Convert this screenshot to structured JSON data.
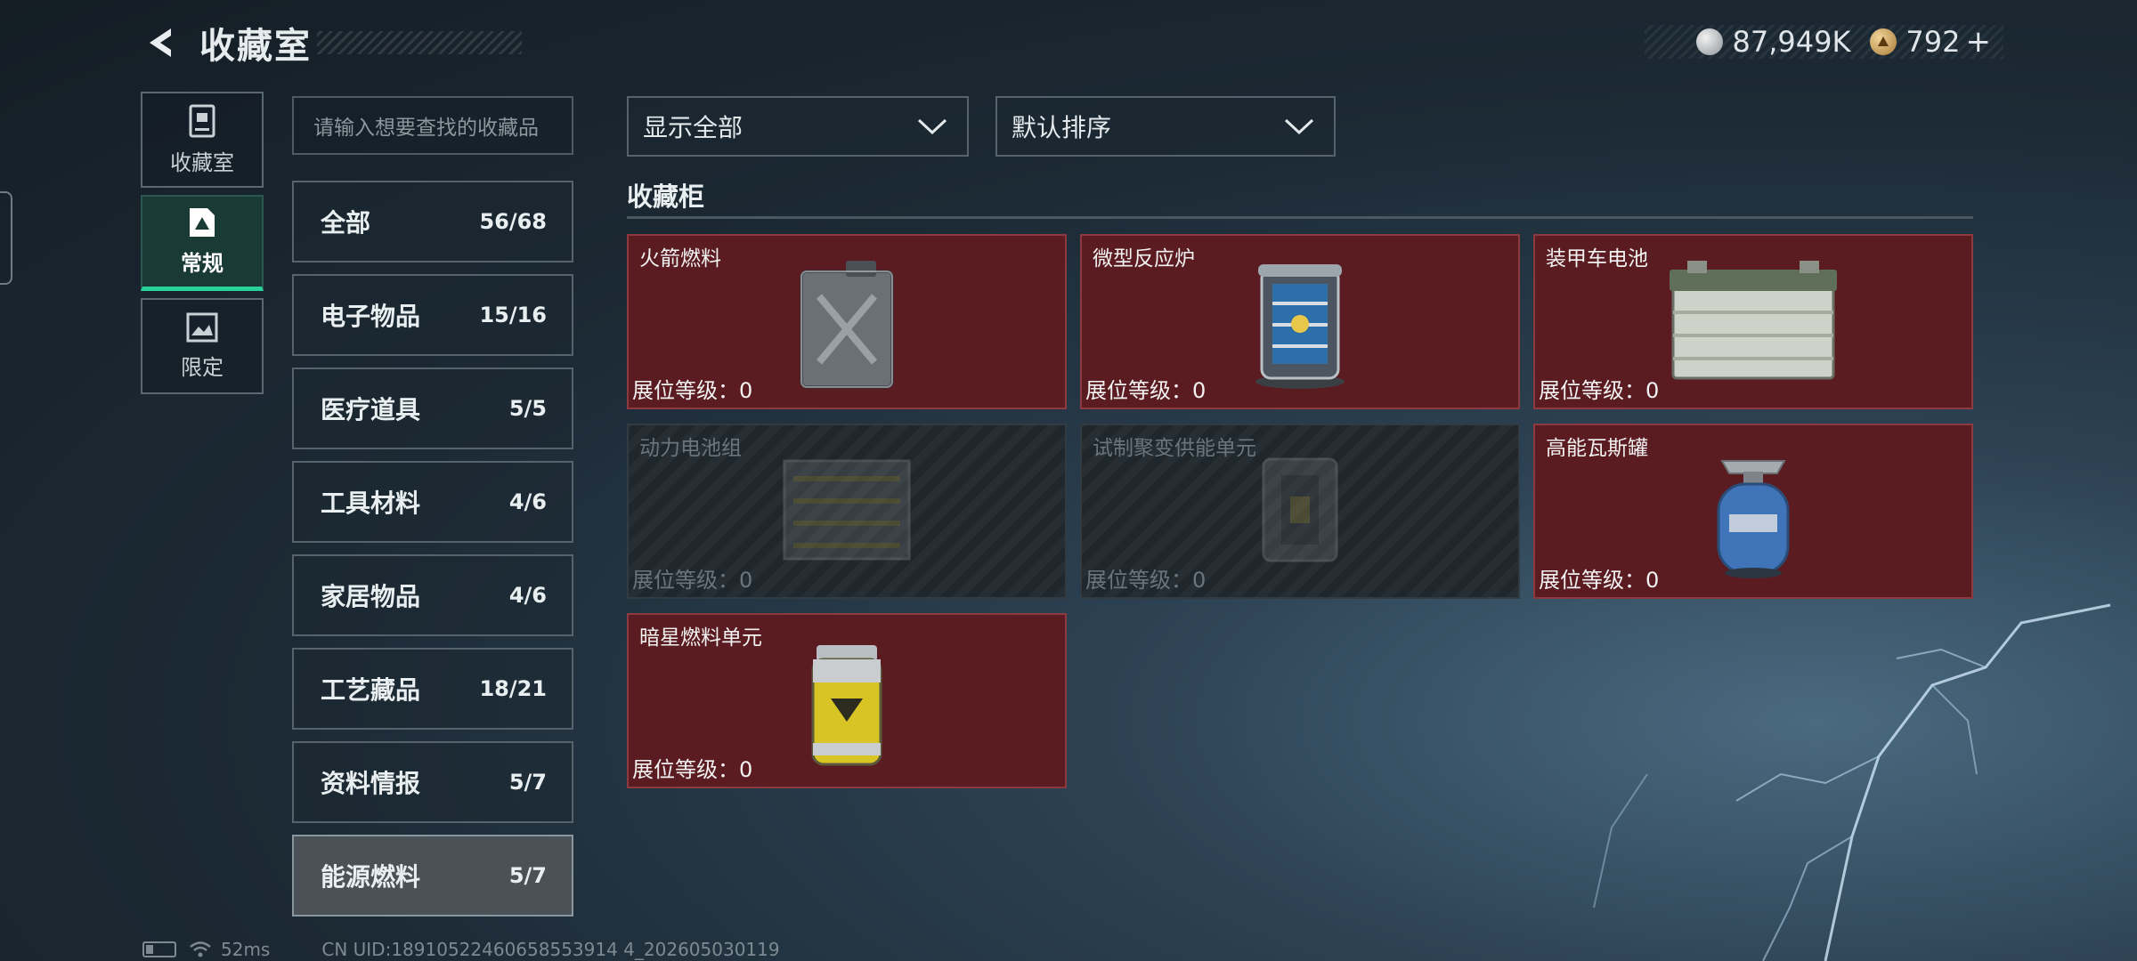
{
  "header": {
    "title": "收藏室",
    "back_icon": "back-arrow-icon"
  },
  "currency": {
    "silver_amount": "87,949K",
    "gold_amount": "792",
    "add_label": "+"
  },
  "mode_nav": [
    {
      "label": "收藏室",
      "icon": "trophy-cabinet-icon",
      "active": false
    },
    {
      "label": "常规",
      "icon": "document-triangle-icon",
      "active": true
    },
    {
      "label": "限定",
      "icon": "limited-picture-icon",
      "active": false
    }
  ],
  "search": {
    "placeholder": "请输入想要查找的收藏品"
  },
  "categories": [
    {
      "name": "全部",
      "count": "56/68"
    },
    {
      "name": "电子物品",
      "count": "15/16"
    },
    {
      "name": "医疗道具",
      "count": "5/5"
    },
    {
      "name": "工具材料",
      "count": "4/6"
    },
    {
      "name": "家居物品",
      "count": "4/6"
    },
    {
      "name": "工艺藏品",
      "count": "18/21"
    },
    {
      "name": "资料情报",
      "count": "5/7"
    },
    {
      "name": "能源燃料",
      "count": "5/7",
      "active": true
    }
  ],
  "filters": {
    "display": "显示全部",
    "sort": "默认排序"
  },
  "section": {
    "title": "收藏柜"
  },
  "items": [
    {
      "name": "火箭燃料",
      "level": "展位等级：0",
      "locked": false,
      "icon": "fuel-canister-icon"
    },
    {
      "name": "微型反应炉",
      "level": "展位等级：0",
      "locked": false,
      "icon": "mini-reactor-icon"
    },
    {
      "name": "装甲车电池",
      "level": "展位等级：0",
      "locked": false,
      "icon": "car-battery-icon"
    },
    {
      "name": "动力电池组",
      "level": "展位等级：0",
      "locked": true,
      "icon": "battery-pack-icon"
    },
    {
      "name": "试制聚变供能单元",
      "level": "展位等级：0",
      "locked": true,
      "icon": "fusion-unit-icon"
    },
    {
      "name": "高能瓦斯罐",
      "level": "展位等级：0",
      "locked": false,
      "icon": "gas-tank-icon"
    },
    {
      "name": "暗星燃料单元",
      "level": "展位等级：0",
      "locked": false,
      "icon": "fuel-cell-icon"
    }
  ],
  "footer": {
    "ping": "52ms",
    "uid": "CN UID:18910522460658553914 4_202605030119"
  },
  "colors": {
    "accent_green": "#27d39a",
    "card_red": "#5a1c21"
  }
}
